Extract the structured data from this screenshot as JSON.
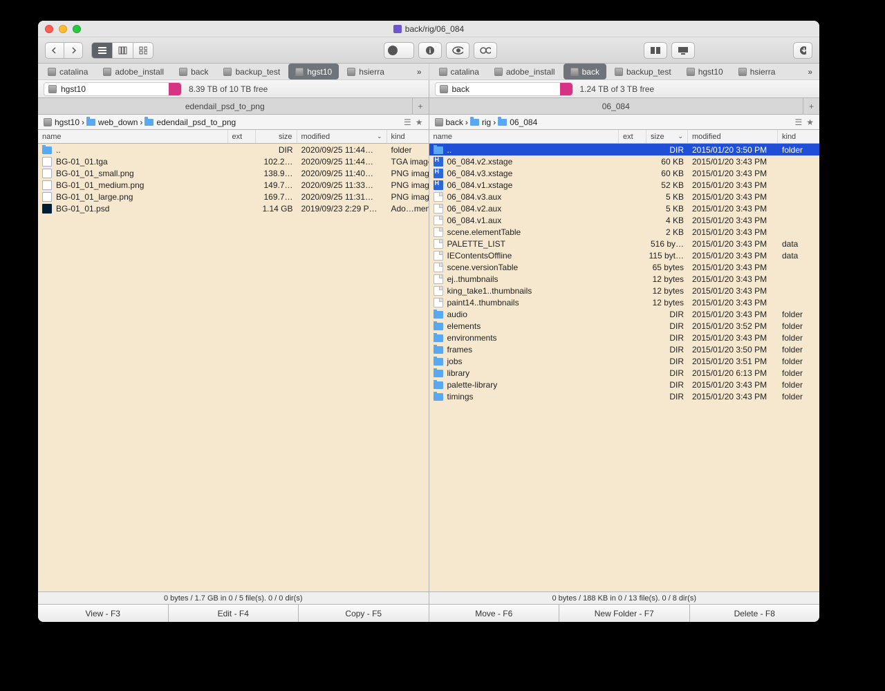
{
  "title_path": "back/rig/06_084",
  "toolbar": {
    "back": "‹",
    "fwd": "›"
  },
  "tabs_left": [
    {
      "label": "catalina",
      "active": false
    },
    {
      "label": "adobe_install",
      "active": false
    },
    {
      "label": "back",
      "active": false
    },
    {
      "label": "backup_test",
      "active": false
    },
    {
      "label": "hgst10",
      "active": true
    },
    {
      "label": "hsierra",
      "active": false
    }
  ],
  "tabs_right": [
    {
      "label": "catalina",
      "active": false
    },
    {
      "label": "adobe_install",
      "active": false
    },
    {
      "label": "back",
      "active": true
    },
    {
      "label": "backup_test",
      "active": false
    },
    {
      "label": "hgst10",
      "active": false
    },
    {
      "label": "hsierra",
      "active": false
    }
  ],
  "drive_left": {
    "name": "hgst10",
    "free": "8.39 TB of 10 TB free"
  },
  "drive_right": {
    "name": "back",
    "free": "1.24 TB of 3 TB free"
  },
  "tabbar_left": "edendail_psd_to_png",
  "tabbar_right": "06_084",
  "breadcrumbs_left": [
    {
      "icon": "disk",
      "label": "hgst10"
    },
    {
      "icon": "folder",
      "label": "web_down"
    },
    {
      "icon": "folder",
      "label": "edendail_psd_to_png"
    }
  ],
  "breadcrumbs_right": [
    {
      "icon": "disk",
      "label": "back"
    },
    {
      "icon": "folder",
      "label": "rig"
    },
    {
      "icon": "folder",
      "label": "06_084"
    }
  ],
  "columns": {
    "name": "name",
    "ext": "ext",
    "size": "size",
    "modified": "modified",
    "kind": "kind"
  },
  "list_left": [
    {
      "icon": "folder",
      "name": "..",
      "size": "DIR",
      "mod": "2020/09/25 11:44…",
      "kind": "folder"
    },
    {
      "icon": "img",
      "name": "BG-01_01.tga",
      "size": "102.2…",
      "mod": "2020/09/25 11:44…",
      "kind": "TGA image"
    },
    {
      "icon": "img",
      "name": "BG-01_01_small.png",
      "size": "138.9…",
      "mod": "2020/09/25 11:40…",
      "kind": "PNG image"
    },
    {
      "icon": "img",
      "name": "BG-01_01_medium.png",
      "size": "149.7…",
      "mod": "2020/09/25 11:33…",
      "kind": "PNG image"
    },
    {
      "icon": "img",
      "name": "BG-01_01_large.png",
      "size": "169.7…",
      "mod": "2020/09/25 11:31…",
      "kind": "PNG image"
    },
    {
      "icon": "psd",
      "name": "BG-01_01.psd",
      "size": "1.14 GB",
      "mod": "2019/09/23 2:29 P…",
      "kind": "Ado…ment"
    }
  ],
  "list_right": [
    {
      "icon": "folder",
      "name": "..",
      "size": "DIR",
      "mod": "2015/01/20 3:50 PM",
      "kind": "folder",
      "sel": true
    },
    {
      "icon": "xst",
      "name": "06_084.v2.xstage",
      "size": "60 KB",
      "mod": "2015/01/20 3:43 PM",
      "kind": ""
    },
    {
      "icon": "xst",
      "name": "06_084.v3.xstage",
      "size": "60 KB",
      "mod": "2015/01/20 3:43 PM",
      "kind": ""
    },
    {
      "icon": "xst",
      "name": "06_084.v1.xstage",
      "size": "52 KB",
      "mod": "2015/01/20 3:43 PM",
      "kind": ""
    },
    {
      "icon": "doc",
      "name": "06_084.v3.aux",
      "size": "5 KB",
      "mod": "2015/01/20 3:43 PM",
      "kind": ""
    },
    {
      "icon": "doc",
      "name": "06_084.v2.aux",
      "size": "5 KB",
      "mod": "2015/01/20 3:43 PM",
      "kind": ""
    },
    {
      "icon": "doc",
      "name": "06_084.v1.aux",
      "size": "4 KB",
      "mod": "2015/01/20 3:43 PM",
      "kind": ""
    },
    {
      "icon": "doc",
      "name": "scene.elementTable",
      "size": "2 KB",
      "mod": "2015/01/20 3:43 PM",
      "kind": ""
    },
    {
      "icon": "doc",
      "name": "PALETTE_LIST",
      "size": "516 by…",
      "mod": "2015/01/20 3:43 PM",
      "kind": "data"
    },
    {
      "icon": "doc",
      "name": "IEContentsOffline",
      "size": "115 byt…",
      "mod": "2015/01/20 3:43 PM",
      "kind": "data"
    },
    {
      "icon": "doc",
      "name": "scene.versionTable",
      "size": "65 bytes",
      "mod": "2015/01/20 3:43 PM",
      "kind": ""
    },
    {
      "icon": "doc",
      "name": "ej..thumbnails",
      "size": "12 bytes",
      "mod": "2015/01/20 3:43 PM",
      "kind": ""
    },
    {
      "icon": "doc",
      "name": "king_take1..thumbnails",
      "size": "12 bytes",
      "mod": "2015/01/20 3:43 PM",
      "kind": ""
    },
    {
      "icon": "doc",
      "name": "paint14..thumbnails",
      "size": "12 bytes",
      "mod": "2015/01/20 3:43 PM",
      "kind": ""
    },
    {
      "icon": "folder",
      "name": "audio",
      "size": "DIR",
      "mod": "2015/01/20 3:43 PM",
      "kind": "folder"
    },
    {
      "icon": "folder",
      "name": "elements",
      "size": "DIR",
      "mod": "2015/01/20 3:52 PM",
      "kind": "folder"
    },
    {
      "icon": "folder",
      "name": "environments",
      "size": "DIR",
      "mod": "2015/01/20 3:43 PM",
      "kind": "folder"
    },
    {
      "icon": "folder",
      "name": "frames",
      "size": "DIR",
      "mod": "2015/01/20 3:50 PM",
      "kind": "folder"
    },
    {
      "icon": "folder",
      "name": "jobs",
      "size": "DIR",
      "mod": "2015/01/20 3:51 PM",
      "kind": "folder"
    },
    {
      "icon": "folder",
      "name": "library",
      "size": "DIR",
      "mod": "2015/01/20 6:13 PM",
      "kind": "folder"
    },
    {
      "icon": "folder",
      "name": "palette-library",
      "size": "DIR",
      "mod": "2015/01/20 3:43 PM",
      "kind": "folder"
    },
    {
      "icon": "folder",
      "name": "timings",
      "size": "DIR",
      "mod": "2015/01/20 3:43 PM",
      "kind": "folder"
    }
  ],
  "status_left": "0 bytes / 1.7 GB in 0 / 5 file(s). 0 / 0 dir(s)",
  "status_right": "0 bytes / 188 KB in 0 / 13 file(s). 0 / 8 dir(s)",
  "fkeys": [
    "View - F3",
    "Edit - F4",
    "Copy - F5",
    "Move - F6",
    "New Folder - F7",
    "Delete - F8"
  ]
}
